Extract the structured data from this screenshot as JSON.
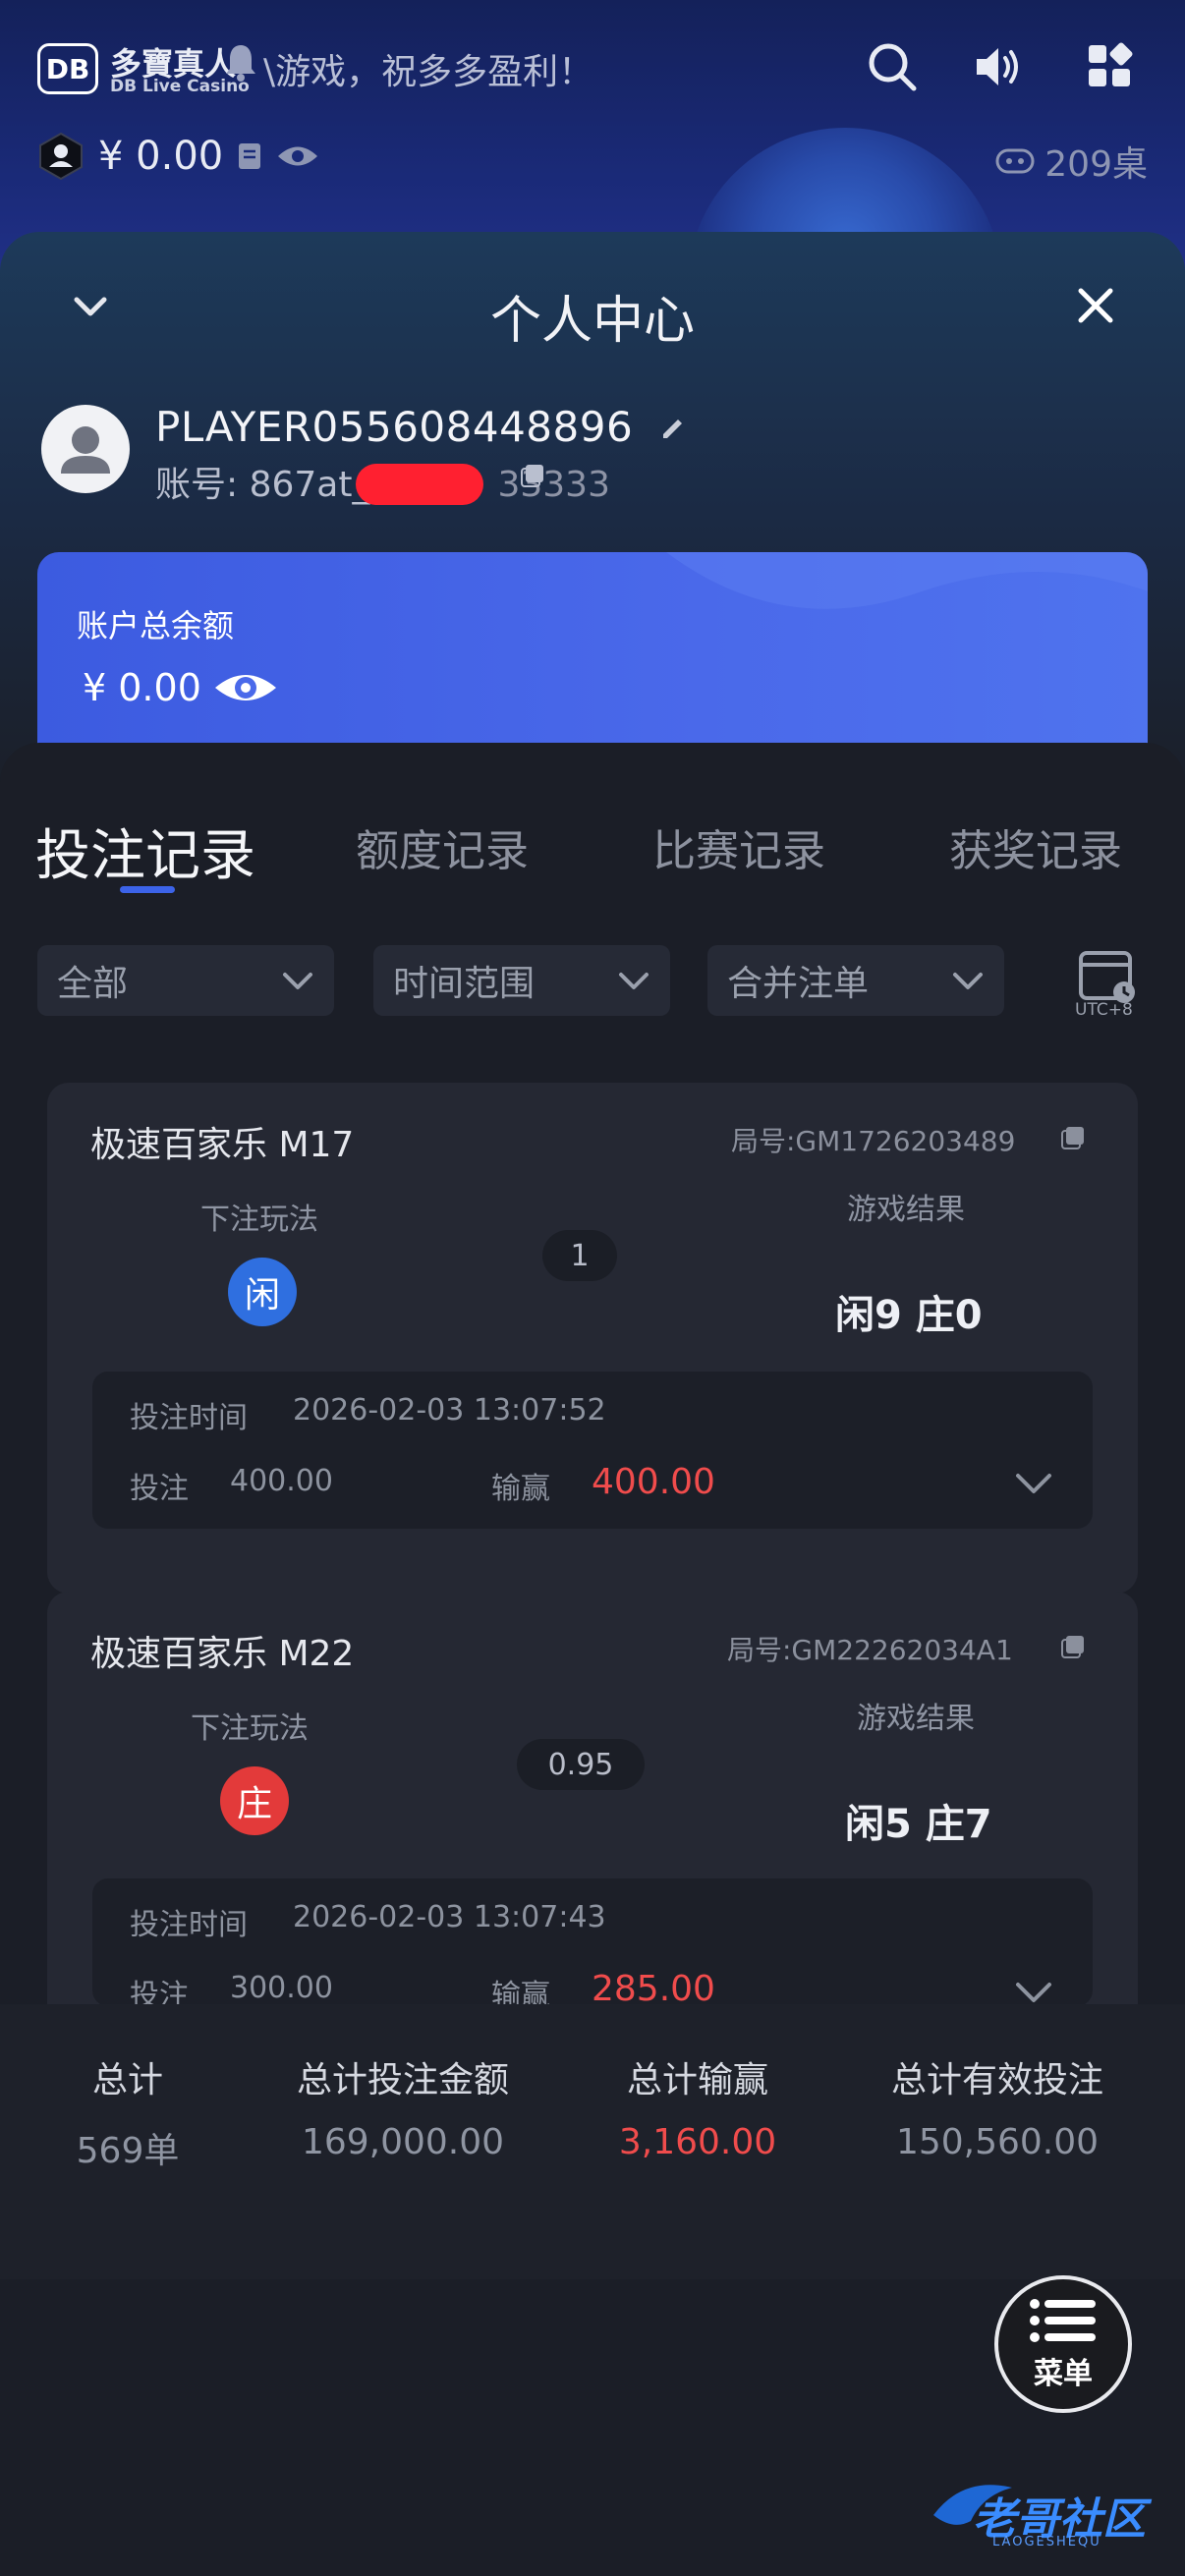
{
  "header": {
    "logo_mark": "DB",
    "logo_cn": "多寶真人",
    "logo_en": "DB Live Casino",
    "marquee": "\\游戏，祝多多盈利！",
    "balance": "¥ 0.00",
    "table_count": "209桌"
  },
  "sheet": {
    "title": "个人中心",
    "player_name": "PLAYER055608448896",
    "account_label": "账号: 867at_",
    "account_suffix": "33333"
  },
  "balance_card": {
    "label": "账户总余额",
    "value": "¥ 0.00"
  },
  "tabs": [
    "投注记录",
    "额度记录",
    "比赛记录",
    "获奖记录"
  ],
  "filters": [
    "全部",
    "时间范围",
    "合并注单"
  ],
  "timezone": "UTC+8",
  "records": [
    {
      "game": "极速百家乐 M17",
      "round": "局号:GM1726203489",
      "bet_type_label": "下注玩法",
      "bet_choice": "闲",
      "odds": "1",
      "result_label": "游戏结果",
      "result": "闲9 庄0",
      "time_label": "投注时间",
      "time": "2026-02-03 13:07:52",
      "bet_label": "投注",
      "bet": "400.00",
      "win_label": "输赢",
      "win": "400.00"
    },
    {
      "game": "极速百家乐 M22",
      "round": "局号:GM22262034A1",
      "bet_type_label": "下注玩法",
      "bet_choice": "庄",
      "odds": "0.95",
      "result_label": "游戏结果",
      "result": "闲5 庄7",
      "time_label": "投注时间",
      "time": "2026-02-03 13:07:43",
      "bet_label": "投注",
      "bet": "300.00",
      "win_label": "输赢",
      "win": "285.00"
    }
  ],
  "summary": {
    "headers": [
      "总计",
      "总计投注金额",
      "总计输赢",
      "总计有效投注"
    ],
    "values": [
      "569单",
      "169,000.00",
      "3,160.00",
      "150,560.00"
    ]
  },
  "menu_label": "菜单",
  "watermark": "老哥社区",
  "watermark_sub": "LAOGESHEQU",
  "colors": {
    "accent_blue": "#3c63e8",
    "player_chip": "#2f6fe0",
    "banker_chip": "#e33a3a",
    "win_red": "#f04c4c"
  }
}
